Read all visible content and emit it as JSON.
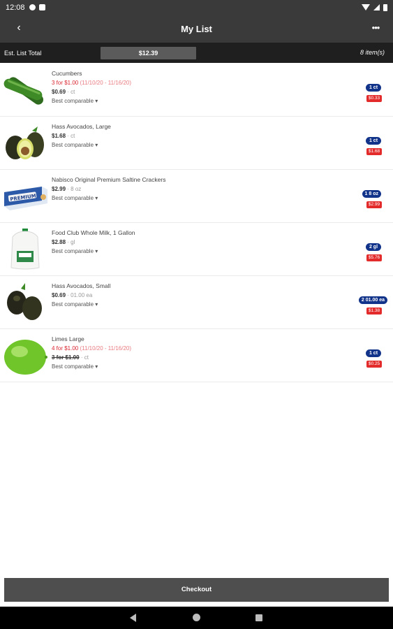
{
  "status_bar": {
    "time": "12:08"
  },
  "app_bar": {
    "back_icon": "‹",
    "title": "My List",
    "more_icon": "•••"
  },
  "summary": {
    "label": "Est. List Total",
    "total": "$12.39",
    "count": "8 item(s)"
  },
  "items": [
    {
      "name": "Cucumbers",
      "promo": "3 for $1.00",
      "promo_dates": "(11/10/20 - 11/16/20)",
      "price": "$0.69",
      "unit": "· ct",
      "best": "Best comparable ▾",
      "qty": "1 ct",
      "row_price": "$0.33"
    },
    {
      "name": "Hass Avocados, Large",
      "price": "$1.68",
      "unit": "· ct",
      "best": "Best comparable ▾",
      "qty": "1 ct",
      "row_price": "$1.68"
    },
    {
      "name": "Nabisco Original Premium Saltine Crackers",
      "price": "$2.99",
      "unit": "· 8 oz",
      "best": "Best comparable ▾",
      "qty": "1 8 oz",
      "row_price": "$2.99"
    },
    {
      "name": "Food Club Whole Milk, 1 Gallon",
      "price": "$2.88",
      "unit": "· gl",
      "best": "Best comparable ▾",
      "qty": "2 gl",
      "row_price": "$5.76"
    },
    {
      "name": "Hass Avocados, Small",
      "price": "$0.69",
      "unit": "· 01.00 ea",
      "best": "Best comparable ▾",
      "qty": "2 01.00 ea",
      "row_price": "$1.38"
    },
    {
      "name": "Limes Large",
      "promo": "4 for $1.00",
      "promo_dates": "(11/10/20 - 11/16/20)",
      "price": "3 for $1.00",
      "unit": "· ct",
      "price_struck": true,
      "best": "Best comparable ▾",
      "qty": "1 ct",
      "row_price": "$0.25"
    }
  ],
  "checkout_label": "Checkout",
  "colors": {
    "bar": "#3a3a3a",
    "summary": "#1f1f1f",
    "badge_blue": "#12338a",
    "badge_red": "#e32b2b",
    "promo_red": "#d9232e"
  }
}
